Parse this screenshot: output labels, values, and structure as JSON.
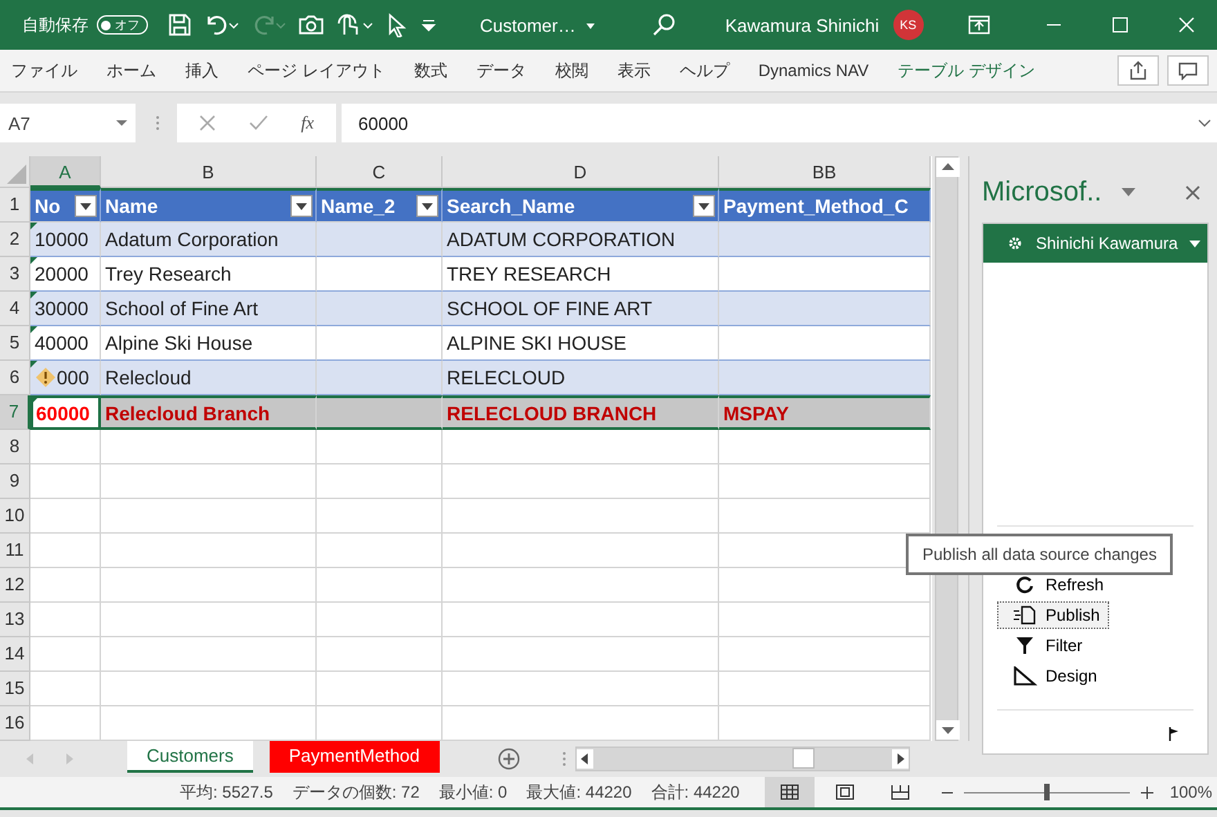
{
  "title_bar": {
    "autosave_label": "自動保存",
    "autosave_toggle": {
      "label": "オフ",
      "on": false
    },
    "document_title": "Customer…",
    "user_name": "Kawamura Shinichi",
    "user_initials": "KS"
  },
  "ribbon_tabs": [
    {
      "label": "ファイル",
      "kind": "normal"
    },
    {
      "label": "ホーム",
      "kind": "normal"
    },
    {
      "label": "挿入",
      "kind": "normal"
    },
    {
      "label": "ページ レイアウト",
      "kind": "normal"
    },
    {
      "label": "数式",
      "kind": "normal"
    },
    {
      "label": "データ",
      "kind": "normal"
    },
    {
      "label": "校閲",
      "kind": "normal"
    },
    {
      "label": "表示",
      "kind": "normal"
    },
    {
      "label": "ヘルプ",
      "kind": "normal"
    },
    {
      "label": "Dynamics NAV",
      "kind": "normal"
    },
    {
      "label": "テーブル デザイン",
      "kind": "contextual"
    }
  ],
  "formula_bar": {
    "name_box": "A7",
    "function_label": "fx",
    "value": "60000"
  },
  "sheet": {
    "columns": [
      {
        "label": "A",
        "selected": true
      },
      {
        "label": "B",
        "selected": false
      },
      {
        "label": "C",
        "selected": false
      },
      {
        "label": "D",
        "selected": false
      },
      {
        "label": "BB",
        "selected": false
      }
    ],
    "table_headers": [
      "No",
      "Name",
      "Name_2",
      "Search_Name",
      "Payment_Method_C"
    ],
    "rows": [
      {
        "num": "2",
        "banded": true,
        "changed": false,
        "warning": false,
        "selected": false,
        "cells": [
          "10000",
          "Adatum Corporation",
          null,
          "ADATUM CORPORATION",
          null
        ]
      },
      {
        "num": "3",
        "banded": false,
        "changed": false,
        "warning": false,
        "selected": false,
        "cells": [
          "20000",
          "Trey Research",
          null,
          "TREY RESEARCH",
          null
        ]
      },
      {
        "num": "4",
        "banded": true,
        "changed": false,
        "warning": false,
        "selected": false,
        "cells": [
          "30000",
          "School of Fine Art",
          null,
          "SCHOOL OF FINE ART",
          null
        ]
      },
      {
        "num": "5",
        "banded": false,
        "changed": false,
        "warning": false,
        "selected": false,
        "cells": [
          "40000",
          "Alpine Ski House",
          null,
          "ALPINE SKI HOUSE",
          null
        ]
      },
      {
        "num": "6",
        "banded": true,
        "changed": false,
        "warning": true,
        "selected": false,
        "cells": [
          "000",
          "Relecloud",
          null,
          "RELECLOUD",
          null
        ]
      },
      {
        "num": "7",
        "banded": false,
        "changed": true,
        "warning": false,
        "selected": true,
        "cells": [
          "60000",
          "Relecloud Branch",
          null,
          "RELECLOUD BRANCH",
          "MSPAY"
        ]
      }
    ],
    "header_row_num": "1",
    "empty_rows": [
      "8",
      "9",
      "10",
      "11",
      "12",
      "13",
      "14",
      "15",
      "16"
    ]
  },
  "sheet_tabs": [
    {
      "label": "Customers",
      "selected": true
    },
    {
      "label": "PaymentMethod",
      "selected": false,
      "color": "#ff0000"
    }
  ],
  "status_bar": {
    "stats": [
      "平均: 5527.5",
      "データの個数: 72",
      "最小値: 0",
      "最大値: 44220",
      "合計: 44220"
    ],
    "views": [
      {
        "kind": "normal",
        "selected": true
      },
      {
        "kind": "page-layout",
        "selected": false
      },
      {
        "kind": "page-break",
        "selected": false
      }
    ],
    "zoom": {
      "level": 0.5,
      "label": "100%"
    }
  },
  "task_pane": {
    "title": "Microsof..",
    "user": "Shinichi Kawamura",
    "actions": [
      {
        "label": "Refresh",
        "kind": "refresh",
        "focused": false
      },
      {
        "label": "Publish",
        "kind": "publish",
        "focused": true
      },
      {
        "label": "Filter",
        "kind": "filter",
        "focused": false
      },
      {
        "label": "Design",
        "kind": "design",
        "focused": false
      }
    ],
    "tooltip": "Publish all data source changes"
  }
}
